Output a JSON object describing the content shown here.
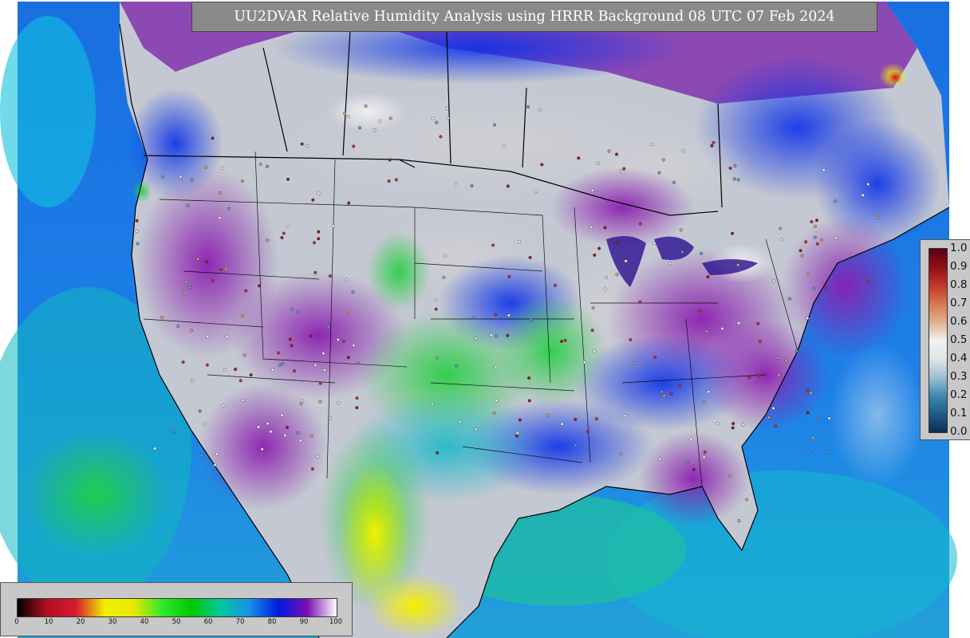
{
  "title": "UU2DVAR Relative Humidity Analysis using HRRR Background 08 UTC 07 Feb 2024",
  "map": {
    "field": "relative-humidity-analysis",
    "projection": "lambert-conformal",
    "ocean_color": "#1e7de0",
    "land_dry_color": "#d2d2d2",
    "moist_color": "#6b1a96"
  },
  "rh_colorbar": {
    "ticks": [
      "0",
      "10",
      "20",
      "30",
      "40",
      "50",
      "60",
      "70",
      "80",
      "90",
      "100"
    ],
    "colors": [
      "#000000",
      "#b01020",
      "#d81830",
      "#f0f000",
      "#e8e800",
      "#2ee82e",
      "#00c800",
      "#00c8a0",
      "#1890e8",
      "#0018e0",
      "#7a0fb0",
      "#ffffff"
    ]
  },
  "obs_colorbar": {
    "ticks": [
      "0.0",
      "0.1",
      "0.2",
      "0.3",
      "0.4",
      "0.5",
      "0.6",
      "0.7",
      "0.8",
      "0.9",
      "1.0"
    ],
    "colors": [
      "#0b2f52",
      "#1f5b8a",
      "#3f8ab0",
      "#9cc0d4",
      "#e0e4e6",
      "#f2f2f2",
      "#e0b08c",
      "#d87850",
      "#c03828",
      "#901018",
      "#5a0010"
    ]
  }
}
